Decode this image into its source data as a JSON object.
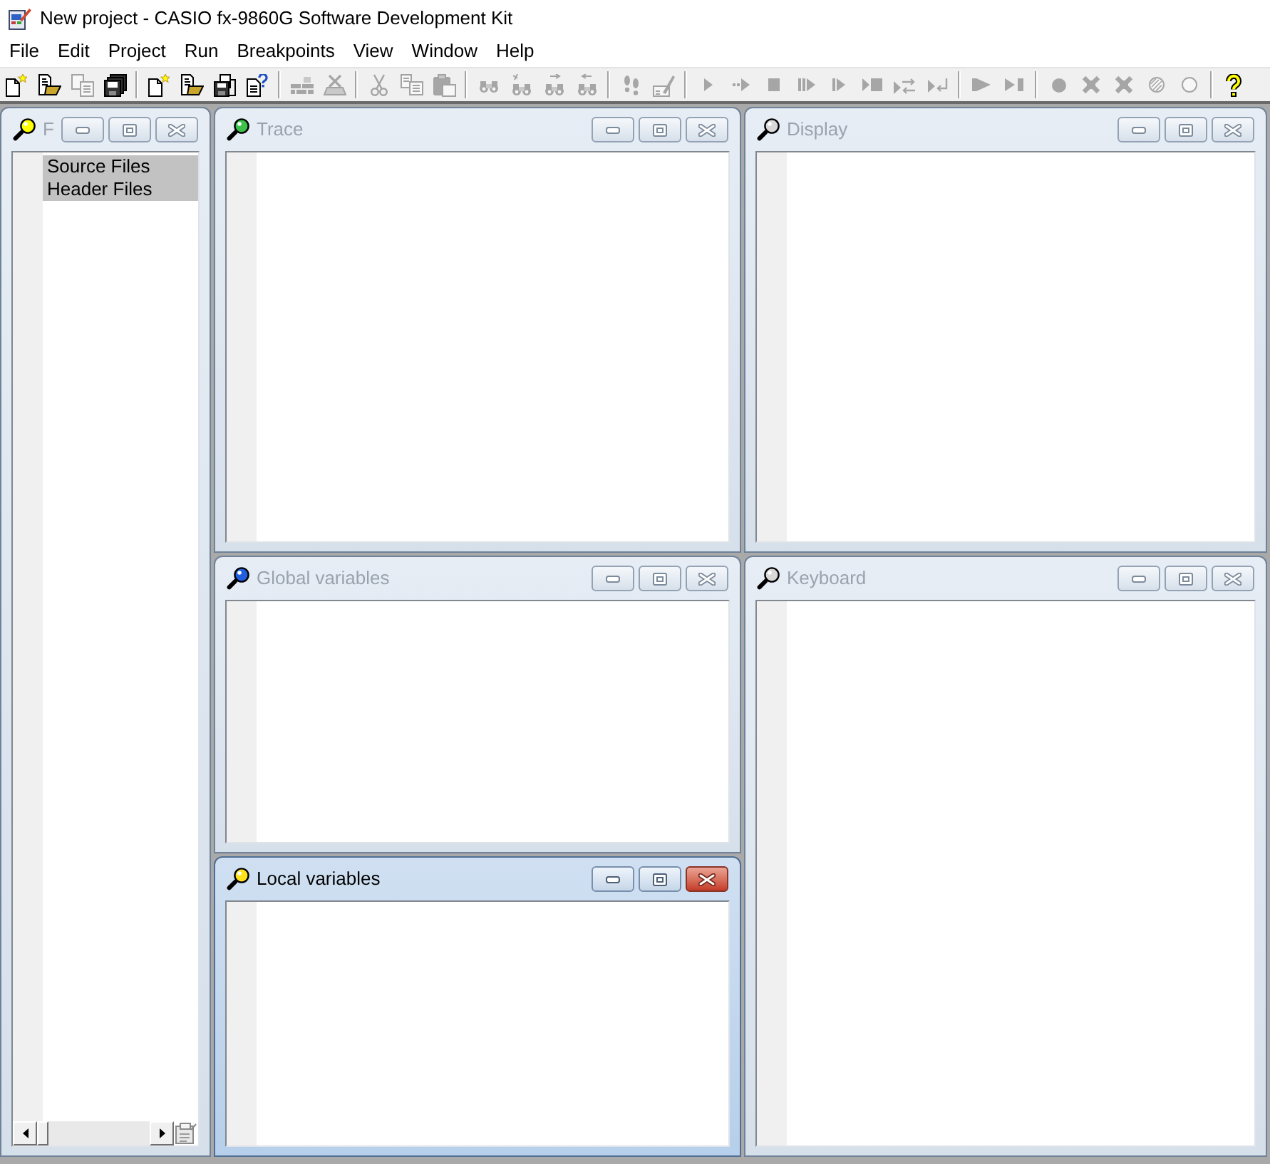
{
  "window": {
    "title": "New project - CASIO fx-9860G Software Development Kit"
  },
  "menu": [
    "File",
    "Edit",
    "Project",
    "Run",
    "Breakpoints",
    "View",
    "Window",
    "Help"
  ],
  "toolbar": [
    [
      {
        "kind": "new-file",
        "disabled": false
      },
      {
        "kind": "open-file",
        "disabled": false
      },
      {
        "kind": "copy-file",
        "disabled": true
      },
      {
        "kind": "save-all",
        "disabled": false
      }
    ],
    [
      {
        "kind": "new-file",
        "disabled": false
      },
      {
        "kind": "open-file",
        "disabled": false
      },
      {
        "kind": "save-project",
        "disabled": false
      },
      {
        "kind": "page-question",
        "disabled": false
      }
    ],
    [
      {
        "kind": "build",
        "disabled": true
      },
      {
        "kind": "compile",
        "disabled": true
      }
    ],
    [
      {
        "kind": "cut",
        "disabled": true
      },
      {
        "kind": "copy",
        "disabled": true
      },
      {
        "kind": "paste",
        "disabled": true
      }
    ],
    [
      {
        "kind": "find",
        "disabled": true
      },
      {
        "kind": "find-mark",
        "disabled": true
      },
      {
        "kind": "find-next",
        "disabled": true
      },
      {
        "kind": "find-prev",
        "disabled": true
      }
    ],
    [
      {
        "kind": "footsteps",
        "disabled": true
      },
      {
        "kind": "edit",
        "disabled": true
      }
    ],
    [
      {
        "kind": "run",
        "disabled": true
      },
      {
        "kind": "run-dotted",
        "disabled": true
      },
      {
        "kind": "stop",
        "disabled": true
      },
      {
        "kind": "step-bars",
        "disabled": true
      },
      {
        "kind": "step-bar",
        "disabled": true
      },
      {
        "kind": "play-stop",
        "disabled": true
      },
      {
        "kind": "swap",
        "disabled": true
      },
      {
        "kind": "play-return",
        "disabled": true
      }
    ],
    [
      {
        "kind": "play-wide",
        "disabled": true
      },
      {
        "kind": "play-end",
        "disabled": true
      }
    ],
    [
      {
        "kind": "breakpoint",
        "disabled": true
      },
      {
        "kind": "cross",
        "disabled": true
      },
      {
        "kind": "cross",
        "disabled": true
      },
      {
        "kind": "hatched-circle",
        "disabled": true
      },
      {
        "kind": "ring",
        "disabled": true
      }
    ],
    [
      {
        "kind": "help",
        "disabled": false
      }
    ]
  ],
  "panes": [
    {
      "kind": "files",
      "title": "F",
      "active": false,
      "items": [
        {
          "label": "Source Files",
          "selected": true
        },
        {
          "label": "Header Files",
          "selected": true
        }
      ]
    },
    {
      "kind": "trace",
      "title": "Trace",
      "active": false
    },
    {
      "kind": "display",
      "title": "Display",
      "active": false
    },
    {
      "kind": "globals",
      "title": "Global variables",
      "active": false
    },
    {
      "kind": "keyboard",
      "title": "Keyboard",
      "active": false
    },
    {
      "kind": "locals",
      "title": "Local variables",
      "active": true
    }
  ]
}
